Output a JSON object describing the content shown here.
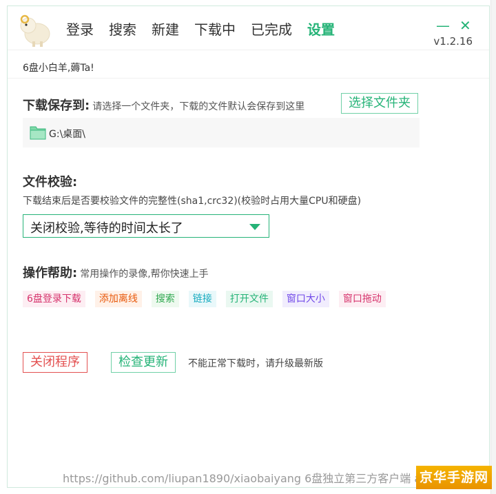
{
  "nav": {
    "items": [
      {
        "label": "登录",
        "active": false
      },
      {
        "label": "搜索",
        "active": false
      },
      {
        "label": "新建",
        "active": false
      },
      {
        "label": "下载中",
        "active": false
      },
      {
        "label": "已完成",
        "active": false
      },
      {
        "label": "设置",
        "active": true
      }
    ]
  },
  "window": {
    "minimize_icon": "minimize-icon",
    "close_icon": "close-icon",
    "version": "v1.2.16"
  },
  "greeting": "6盘小白羊,薅Ta!",
  "download": {
    "title": "下载保存到:",
    "hint": "请选择一个文件夹，下载的文件默认会保存到这里",
    "choose_button": "选择文件夹",
    "path": "G:\\桌面\\"
  },
  "verify": {
    "title": "文件校验:",
    "description": "下载结束后是否要校验文件的完整性(sha1,crc32)(校验时占用大量CPU和硬盘)",
    "selected": "关闭校验,等待的时间太长了"
  },
  "help": {
    "title": "操作帮助:",
    "hint": "常用操作的录像,帮你快速上手",
    "tags": [
      {
        "label": "6盘登录下载",
        "color": "#d6336c",
        "bg": "#fdeef3"
      },
      {
        "label": "添加离线",
        "color": "#e8590c",
        "bg": "#fff1e8"
      },
      {
        "label": "搜索",
        "color": "#2fa84f",
        "bg": "#eef9ef"
      },
      {
        "label": "链接",
        "color": "#15aabf",
        "bg": "#e9f8fa"
      },
      {
        "label": "打开文件",
        "color": "#25b377",
        "bg": "#eaf8f1"
      },
      {
        "label": "窗口大小",
        "color": "#7048e8",
        "bg": "#f1edfd"
      },
      {
        "label": "窗口拖动",
        "color": "#d6336c",
        "bg": "#fdeef3"
      }
    ]
  },
  "actions": {
    "close_program": "关闭程序",
    "check_update": "检查更新",
    "update_note": "不能正常下载时，请升级最新版"
  },
  "footer": {
    "text": "https://github.com/liupan1890/xiaobaiyang    6盘独立第三方客户端    anxiaz.net"
  },
  "watermark": "京华手游网",
  "colors": {
    "accent": "#25b377",
    "danger": "#e35050"
  }
}
